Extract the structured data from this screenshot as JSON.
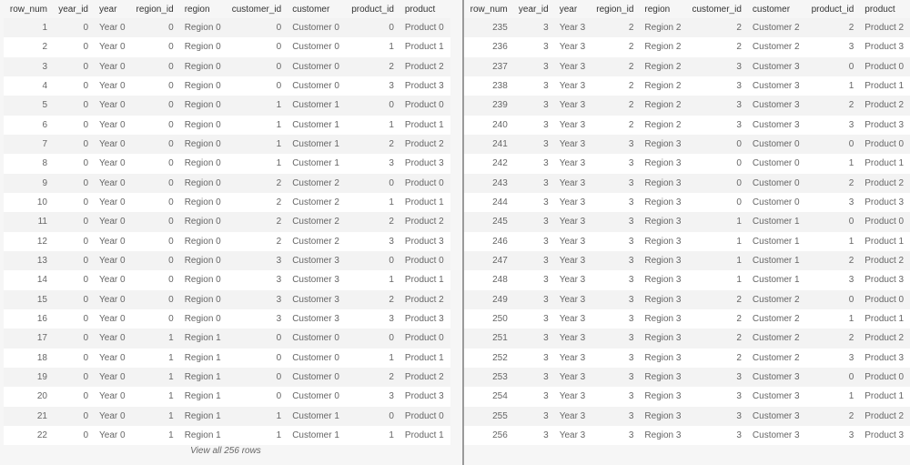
{
  "columns": [
    "row_num",
    "year_id",
    "year",
    "region_id",
    "region",
    "customer_id",
    "customer",
    "product_id",
    "product"
  ],
  "left_rows": [
    [
      1,
      0,
      "Year 0",
      0,
      "Region 0",
      0,
      "Customer 0",
      0,
      "Product 0"
    ],
    [
      2,
      0,
      "Year 0",
      0,
      "Region 0",
      0,
      "Customer 0",
      1,
      "Product 1"
    ],
    [
      3,
      0,
      "Year 0",
      0,
      "Region 0",
      0,
      "Customer 0",
      2,
      "Product 2"
    ],
    [
      4,
      0,
      "Year 0",
      0,
      "Region 0",
      0,
      "Customer 0",
      3,
      "Product 3"
    ],
    [
      5,
      0,
      "Year 0",
      0,
      "Region 0",
      1,
      "Customer 1",
      0,
      "Product 0"
    ],
    [
      6,
      0,
      "Year 0",
      0,
      "Region 0",
      1,
      "Customer 1",
      1,
      "Product 1"
    ],
    [
      7,
      0,
      "Year 0",
      0,
      "Region 0",
      1,
      "Customer 1",
      2,
      "Product 2"
    ],
    [
      8,
      0,
      "Year 0",
      0,
      "Region 0",
      1,
      "Customer 1",
      3,
      "Product 3"
    ],
    [
      9,
      0,
      "Year 0",
      0,
      "Region 0",
      2,
      "Customer 2",
      0,
      "Product 0"
    ],
    [
      10,
      0,
      "Year 0",
      0,
      "Region 0",
      2,
      "Customer 2",
      1,
      "Product 1"
    ],
    [
      11,
      0,
      "Year 0",
      0,
      "Region 0",
      2,
      "Customer 2",
      2,
      "Product 2"
    ],
    [
      12,
      0,
      "Year 0",
      0,
      "Region 0",
      2,
      "Customer 2",
      3,
      "Product 3"
    ],
    [
      13,
      0,
      "Year 0",
      0,
      "Region 0",
      3,
      "Customer 3",
      0,
      "Product 0"
    ],
    [
      14,
      0,
      "Year 0",
      0,
      "Region 0",
      3,
      "Customer 3",
      1,
      "Product 1"
    ],
    [
      15,
      0,
      "Year 0",
      0,
      "Region 0",
      3,
      "Customer 3",
      2,
      "Product 2"
    ],
    [
      16,
      0,
      "Year 0",
      0,
      "Region 0",
      3,
      "Customer 3",
      3,
      "Product 3"
    ],
    [
      17,
      0,
      "Year 0",
      1,
      "Region 1",
      0,
      "Customer 0",
      0,
      "Product 0"
    ],
    [
      18,
      0,
      "Year 0",
      1,
      "Region 1",
      0,
      "Customer 0",
      1,
      "Product 1"
    ],
    [
      19,
      0,
      "Year 0",
      1,
      "Region 1",
      0,
      "Customer 0",
      2,
      "Product 2"
    ],
    [
      20,
      0,
      "Year 0",
      1,
      "Region 1",
      0,
      "Customer 0",
      3,
      "Product 3"
    ],
    [
      21,
      0,
      "Year 0",
      1,
      "Region 1",
      1,
      "Customer 1",
      0,
      "Product 0"
    ],
    [
      22,
      0,
      "Year 0",
      1,
      "Region 1",
      1,
      "Customer 1",
      1,
      "Product 1"
    ]
  ],
  "right_rows": [
    [
      235,
      3,
      "Year 3",
      2,
      "Region 2",
      2,
      "Customer 2",
      2,
      "Product 2"
    ],
    [
      236,
      3,
      "Year 3",
      2,
      "Region 2",
      2,
      "Customer 2",
      3,
      "Product 3"
    ],
    [
      237,
      3,
      "Year 3",
      2,
      "Region 2",
      3,
      "Customer 3",
      0,
      "Product 0"
    ],
    [
      238,
      3,
      "Year 3",
      2,
      "Region 2",
      3,
      "Customer 3",
      1,
      "Product 1"
    ],
    [
      239,
      3,
      "Year 3",
      2,
      "Region 2",
      3,
      "Customer 3",
      2,
      "Product 2"
    ],
    [
      240,
      3,
      "Year 3",
      2,
      "Region 2",
      3,
      "Customer 3",
      3,
      "Product 3"
    ],
    [
      241,
      3,
      "Year 3",
      3,
      "Region 3",
      0,
      "Customer 0",
      0,
      "Product 0"
    ],
    [
      242,
      3,
      "Year 3",
      3,
      "Region 3",
      0,
      "Customer 0",
      1,
      "Product 1"
    ],
    [
      243,
      3,
      "Year 3",
      3,
      "Region 3",
      0,
      "Customer 0",
      2,
      "Product 2"
    ],
    [
      244,
      3,
      "Year 3",
      3,
      "Region 3",
      0,
      "Customer 0",
      3,
      "Product 3"
    ],
    [
      245,
      3,
      "Year 3",
      3,
      "Region 3",
      1,
      "Customer 1",
      0,
      "Product 0"
    ],
    [
      246,
      3,
      "Year 3",
      3,
      "Region 3",
      1,
      "Customer 1",
      1,
      "Product 1"
    ],
    [
      247,
      3,
      "Year 3",
      3,
      "Region 3",
      1,
      "Customer 1",
      2,
      "Product 2"
    ],
    [
      248,
      3,
      "Year 3",
      3,
      "Region 3",
      1,
      "Customer 1",
      3,
      "Product 3"
    ],
    [
      249,
      3,
      "Year 3",
      3,
      "Region 3",
      2,
      "Customer 2",
      0,
      "Product 0"
    ],
    [
      250,
      3,
      "Year 3",
      3,
      "Region 3",
      2,
      "Customer 2",
      1,
      "Product 1"
    ],
    [
      251,
      3,
      "Year 3",
      3,
      "Region 3",
      2,
      "Customer 2",
      2,
      "Product 2"
    ],
    [
      252,
      3,
      "Year 3",
      3,
      "Region 3",
      2,
      "Customer 2",
      3,
      "Product 3"
    ],
    [
      253,
      3,
      "Year 3",
      3,
      "Region 3",
      3,
      "Customer 3",
      0,
      "Product 0"
    ],
    [
      254,
      3,
      "Year 3",
      3,
      "Region 3",
      3,
      "Customer 3",
      1,
      "Product 1"
    ],
    [
      255,
      3,
      "Year 3",
      3,
      "Region 3",
      3,
      "Customer 3",
      2,
      "Product 2"
    ],
    [
      256,
      3,
      "Year 3",
      3,
      "Region 3",
      3,
      "Customer 3",
      3,
      "Product 3"
    ]
  ],
  "view_all_label": "View all 256 rows"
}
